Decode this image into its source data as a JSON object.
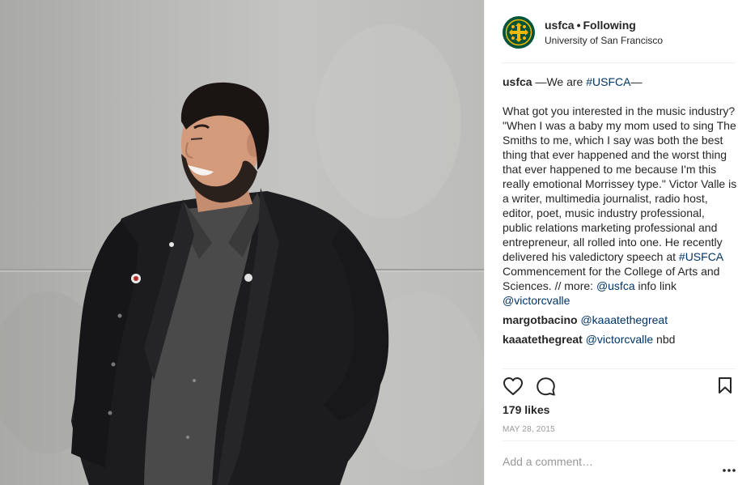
{
  "post": {
    "username": "usfca",
    "separator": "•",
    "follow_status": "Following",
    "location": "University of San Francisco",
    "caption": {
      "username": "usfca",
      "headline_pre": " —We are ",
      "headline_tag": "#USFCA",
      "headline_post": "—",
      "body_1": "What got you interested in the music industry? \"When I was a baby my mom used to sing The Smiths to me, which I say was both the best thing that ever happened and the worst thing that ever happened to me because I'm this really emotional Morrissey type.\" Victor Valle is a writer, multimedia journalist, radio host, editor, poet, music industry professional, public relations marketing professional and entrepreneur, all rolled into one. He recently delivered his valedictory speech at ",
      "body_tag": "#USFCA",
      "body_2": " Commencement for the College of Arts and Sciences. // more: ",
      "body_mention": "@usfca",
      "body_3": " info link ",
      "body_mention2": "@victorcvalle"
    },
    "comments": [
      {
        "username": "margotbacino",
        "mention": "@kaaatethegreat",
        "text": ""
      },
      {
        "username": "kaaatethegreat",
        "mention": "@victorcvalle",
        "text": " nbd"
      }
    ],
    "likes": "179 likes",
    "date": "MAY 28, 2015",
    "add_comment_placeholder": "Add a comment…"
  },
  "icons": {
    "avatar": "usfca-logo-icon",
    "like": "heart-icon",
    "comment": "comment-bubble-icon",
    "save": "bookmark-icon",
    "more": "more-options-icon"
  },
  "colors": {
    "link": "#003569",
    "avatar_bg": "#00543c",
    "avatar_fg": "#f2b800",
    "muted": "#999999"
  }
}
